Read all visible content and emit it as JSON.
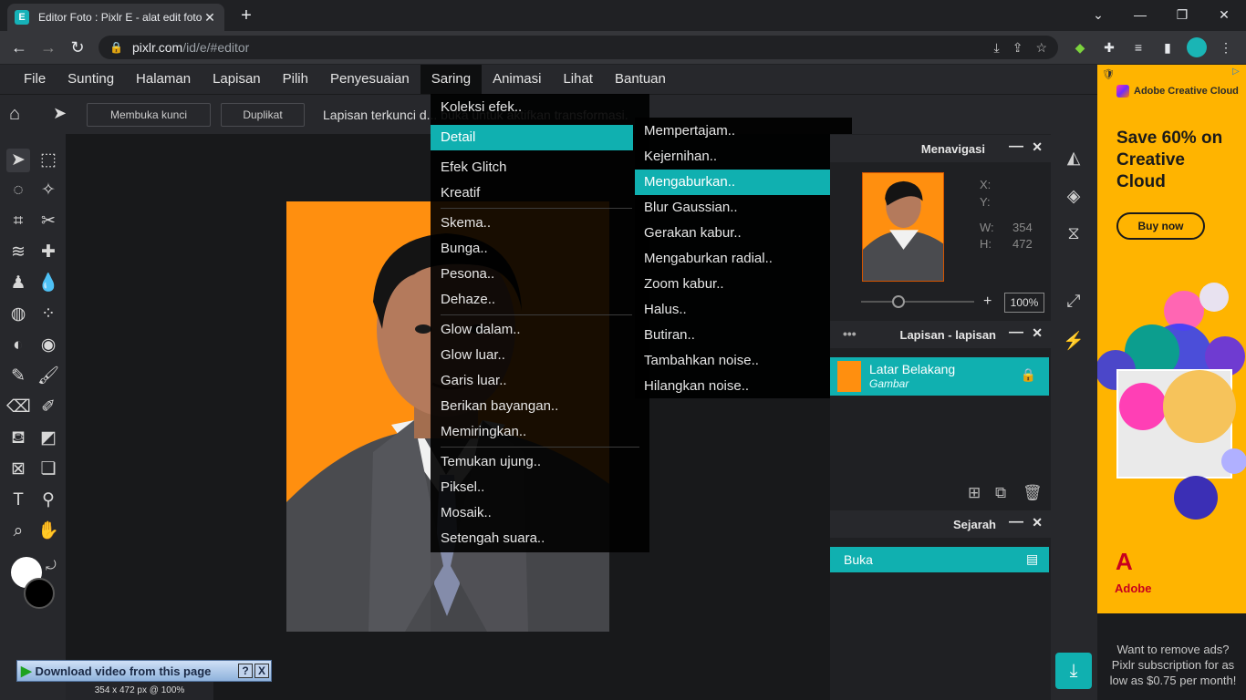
{
  "browser": {
    "tab_title": "Editor Foto : Pixlr E - alat edit foto",
    "tab_close": "✕",
    "new_tab": "+",
    "url_host": "pixlr.com",
    "url_path": "/id/e/#editor",
    "win_minimize": "⌄",
    "win_min": "—",
    "win_restore": "❐",
    "win_close": "✕"
  },
  "menubar": [
    "File",
    "Sunting",
    "Halaman",
    "Lapisan",
    "Pilih",
    "Penyesuaian",
    "Saring",
    "Animasi",
    "Lihat",
    "Bantuan"
  ],
  "toolbar": {
    "unlock_label": "Membuka kunci",
    "duplicate_label": "Duplikat",
    "message": "Lapisan terkunci d... buka untuk aktifkan transformasi."
  },
  "saring_menu": {
    "items": [
      {
        "label": "Koleksi efek.."
      },
      {
        "label": "Detail"
      },
      {
        "label": "Efek Glitch"
      },
      {
        "label": "Kreatif"
      },
      {
        "label": "Skema.."
      },
      {
        "label": "Bunga.."
      },
      {
        "label": "Pesona.."
      },
      {
        "label": "Dehaze.."
      },
      {
        "label": "Glow dalam.."
      },
      {
        "label": "Glow luar.."
      },
      {
        "label": "Garis luar.."
      },
      {
        "label": "Berikan bayangan.."
      },
      {
        "label": "Memiringkan.."
      },
      {
        "label": "Temukan ujung.."
      },
      {
        "label": "Piksel.."
      },
      {
        "label": "Mosaik.."
      },
      {
        "label": "Setengah suara.."
      }
    ],
    "highlighted": "Detail"
  },
  "detail_submenu": {
    "items": [
      {
        "label": "Mempertajam.."
      },
      {
        "label": "Kejernihan.."
      },
      {
        "label": "Mengaburkan.."
      },
      {
        "label": "Blur Gaussian.."
      },
      {
        "label": "Gerakan kabur.."
      },
      {
        "label": "Mengaburkan radial.."
      },
      {
        "label": "Zoom kabur.."
      },
      {
        "label": "Halus.."
      },
      {
        "label": "Butiran.."
      },
      {
        "label": "Tambahkan noise.."
      },
      {
        "label": "Hilangkan noise.."
      }
    ],
    "highlighted": "Mengaburkan.."
  },
  "navigator": {
    "title": "Menavigasi",
    "x_label": "X:",
    "y_label": "Y:",
    "w_label": "W:",
    "w_value": "354",
    "h_label": "H:",
    "h_value": "472",
    "zoom": "100%",
    "zoom_level": 0.33
  },
  "layers": {
    "title": "Lapisan - lapisan",
    "layer_name": "Latar Belakang",
    "layer_type": "Gambar"
  },
  "history": {
    "title": "Sejarah",
    "entry": "Buka"
  },
  "status": {
    "size": "354 x 472 px @ 100%"
  },
  "download_bar": {
    "label": "Download video from this page",
    "help": "?",
    "close": "X"
  },
  "ad": {
    "brand": "Adobe Creative Cloud",
    "headline": "Save 60% on Creative Cloud",
    "button": "Buy now",
    "footer_brand": "Adobe",
    "remove_ads": "Want to remove ads? Pixlr subscription for as low as $0.75 per month!"
  },
  "colors": {
    "accent": "#10b0b0",
    "photo_bg": "#ff8f0f",
    "ad_bg": "#ffb400"
  }
}
